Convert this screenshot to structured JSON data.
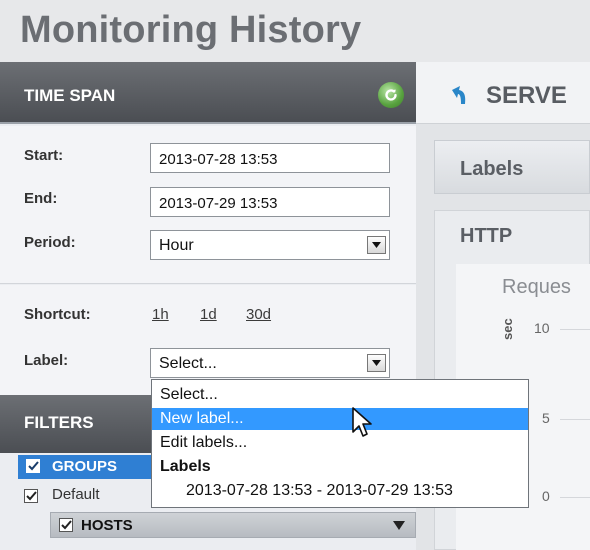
{
  "page": {
    "title": "Monitoring History"
  },
  "time_span": {
    "header": "TIME SPAN",
    "start_label": "Start:",
    "start_value": "2013-07-28 13:53",
    "end_label": "End:",
    "end_value": "2013-07-29 13:53",
    "period_label": "Period:",
    "period_value": "Hour",
    "shortcut_label": "Shortcut:",
    "shortcuts": [
      "1h",
      "1d",
      "30d"
    ],
    "label_label": "Label:",
    "label_value": "Select..."
  },
  "label_dropdown": {
    "items": [
      {
        "text": "Select...",
        "selected": false,
        "kind": "option"
      },
      {
        "text": "New label...",
        "selected": true,
        "kind": "option"
      },
      {
        "text": "Edit labels...",
        "selected": false,
        "kind": "option"
      },
      {
        "text": "Labels",
        "selected": false,
        "kind": "group"
      },
      {
        "text": "2013-07-28 13:53 - 2013-07-29 13:53",
        "selected": false,
        "kind": "sub"
      }
    ]
  },
  "filters": {
    "header": "FILTERS",
    "groups_label": "GROUPS",
    "default_label": "Default",
    "hosts_label": "HOSTS"
  },
  "right_panel": {
    "server_title": "SERVE",
    "labels_title": "Labels",
    "http_title": "HTTP",
    "chart_title": "Reques",
    "y_unit": "sec",
    "y_ticks": [
      "10",
      "5",
      "0"
    ]
  },
  "colors": {
    "header_gray": "#55585d",
    "selection_blue": "#3399ff",
    "groups_blue": "#2f7fd3",
    "refresh_green": "#58a23f"
  },
  "icons": {
    "refresh": "refresh-icon",
    "server": "server-arrow-icon",
    "cursor": "mouse-pointer-icon",
    "dropdown": "chevron-down-icon"
  }
}
